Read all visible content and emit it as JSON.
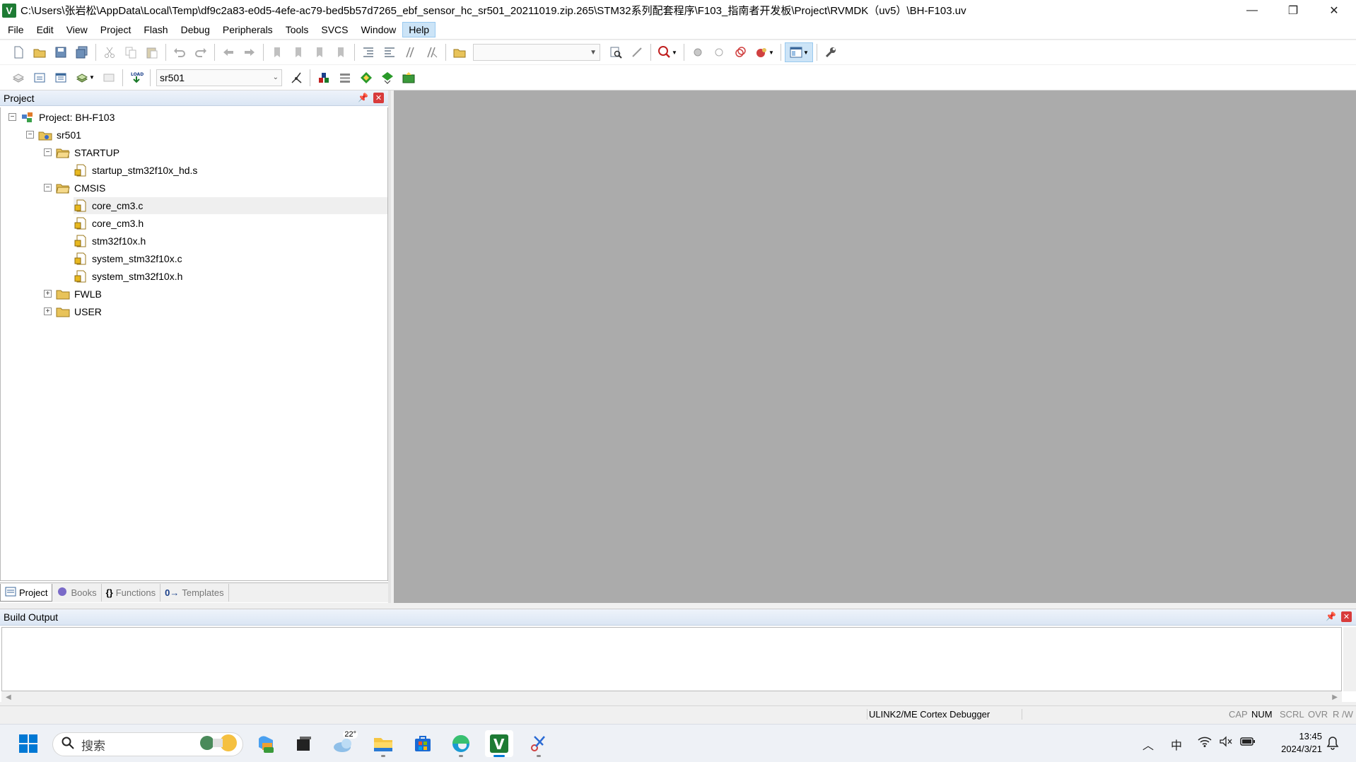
{
  "window": {
    "title": "C:\\Users\\张岩松\\AppData\\Local\\Temp\\df9c2a83-e0d5-4efe-ac79-bed5b57d7265_ebf_sensor_hc_sr501_20211019.zip.265\\STM32系列配套程序\\F103_指南者开发板\\Project\\RVMDK（uv5）\\BH-F103.uv",
    "app_icon_letter": "V",
    "minimize": "—",
    "restore": "❐",
    "close": "✕"
  },
  "menu": {
    "items": [
      "File",
      "Edit",
      "View",
      "Project",
      "Flash",
      "Debug",
      "Peripherals",
      "Tools",
      "SVCS",
      "Window",
      "Help"
    ],
    "active_index": 10
  },
  "toolbar2": {
    "target_value": "sr501",
    "load_label": "LOAD"
  },
  "project_panel": {
    "header": "Project",
    "pin": "📌",
    "close": "✕",
    "tree": {
      "root": "Project: BH-F103",
      "target": "sr501",
      "groups": [
        {
          "name": "STARTUP",
          "expanded": true,
          "files": [
            "startup_stm32f10x_hd.s"
          ]
        },
        {
          "name": "CMSIS",
          "expanded": true,
          "files": [
            "core_cm3.c",
            "core_cm3.h",
            "stm32f10x.h",
            "system_stm32f10x.c",
            "system_stm32f10x.h"
          ]
        },
        {
          "name": "FWLB",
          "expanded": false,
          "files": []
        },
        {
          "name": "USER",
          "expanded": false,
          "files": []
        }
      ],
      "selected_file": "core_cm3.c"
    },
    "tabs": [
      "Project",
      "Books",
      "Functions",
      "Templates"
    ],
    "tab_icons": [
      "{}",
      "0→"
    ],
    "active_tab": "Project"
  },
  "build_output": {
    "header": "Build Output",
    "pin": "📌",
    "close": "✕"
  },
  "statusbar": {
    "debugger": "ULINK2/ME Cortex Debugger",
    "flags": [
      "CAP",
      "NUM",
      "SCRL",
      "OVR",
      "R /W"
    ],
    "active_flags": [
      "NUM"
    ]
  },
  "taskbar": {
    "search_placeholder": "搜索",
    "weather_temp": "22°",
    "ime": "中",
    "time": "13:45",
    "date": "2024/3/21"
  },
  "colors": {
    "editor_bg": "#ababab",
    "keil_green": "#1e7b34",
    "win_blue": "#0078d4"
  }
}
